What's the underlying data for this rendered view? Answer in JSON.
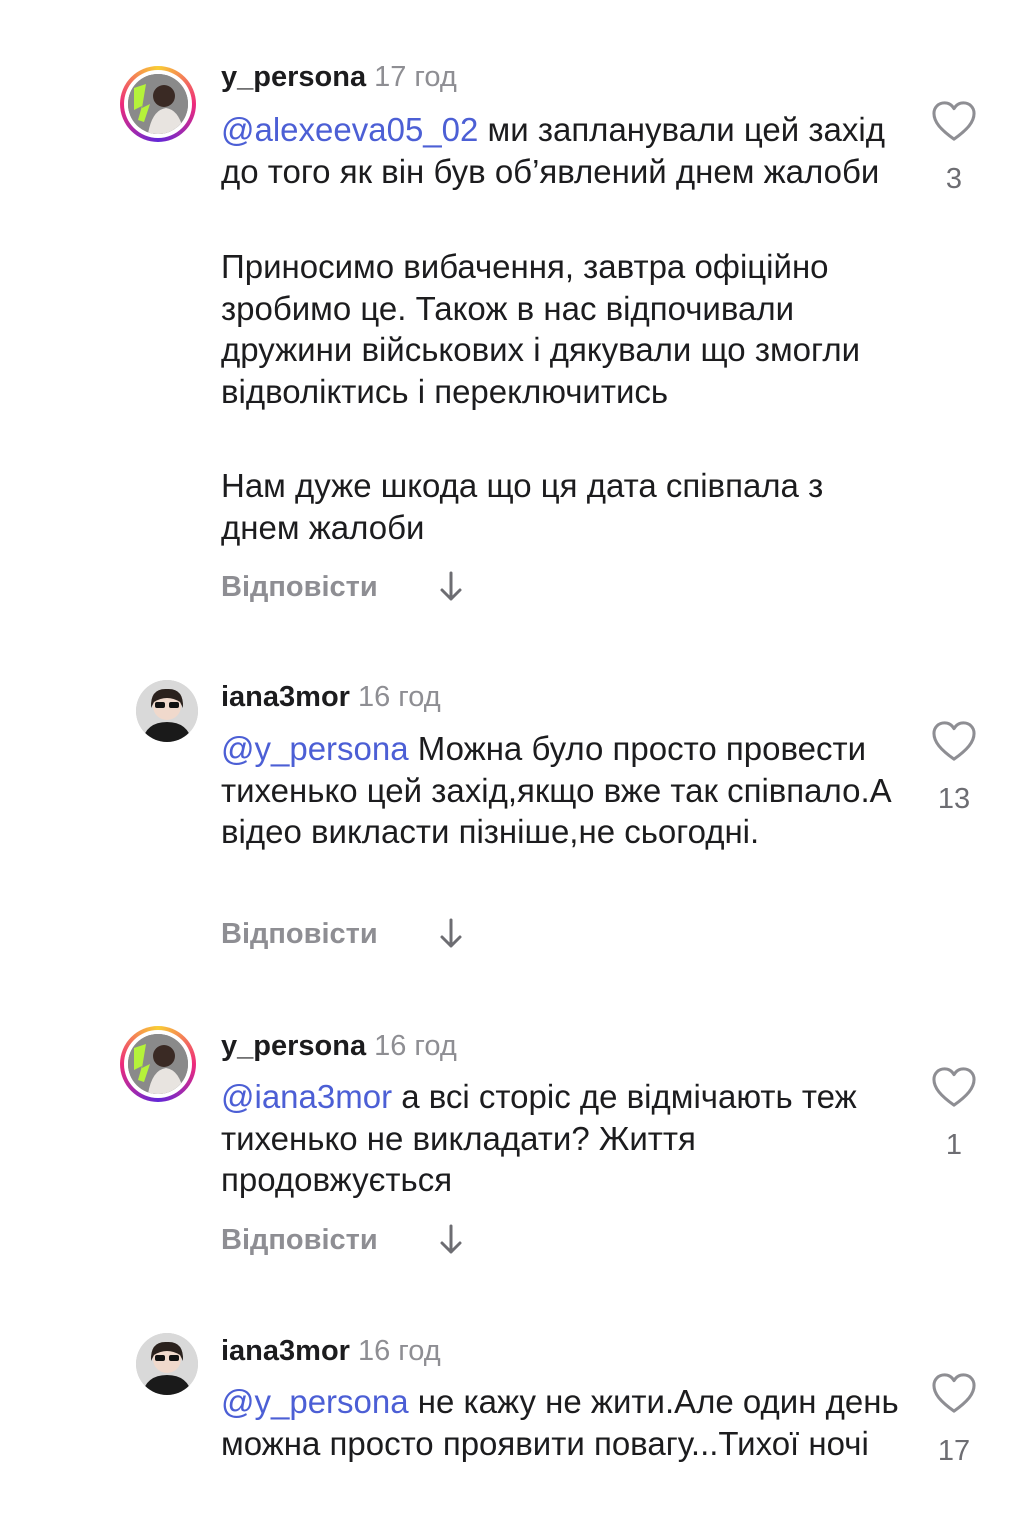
{
  "comments": [
    {
      "username": "y_persona",
      "time": "17 год",
      "avatar": "story-ring-avatar",
      "mention": "@alexeeva05_02",
      "first_text": " ми запланували цей захід до того як він був об’явлений днем жалоби",
      "paragraphs": [
        "Приносимо вибачення, завтра офіційно зробимо це. Також в нас відпочивали дружини військових і дякували що змогли відволіктись і переключитись",
        "Нам дуже шкода що ця дата співпала з днем жалоби"
      ],
      "likes": "3",
      "reply_label": "Відповісти"
    },
    {
      "username": "iana3mor",
      "time": "16 год",
      "avatar": "plain-avatar",
      "mention": "@y_persona",
      "first_text": " Можна було просто провести тихенько цей захід,якщо вже так співпало.А  відео викласти пізніше,не сьогодні.",
      "paragraphs": [],
      "likes": "13",
      "reply_label": "Відповісти"
    },
    {
      "username": "y_persona",
      "time": "16 год",
      "avatar": "story-ring-avatar",
      "mention": "@iana3mor",
      "first_text": " а всі сторіс де відмічають теж тихенько не викладати? Життя продовжується",
      "paragraphs": [],
      "likes": "1",
      "reply_label": "Відповісти"
    },
    {
      "username": "iana3mor",
      "time": "16 год",
      "avatar": "plain-avatar",
      "mention": "@y_persona",
      "first_text": " не кажу не жити.Але один день можна просто проявити повагу...Тихої ночі",
      "paragraphs": [],
      "likes": "17",
      "reply_label": "Відповісти"
    }
  ],
  "icons": {
    "like": "heart-outline-icon",
    "reply_more": "arrow-down-icon"
  },
  "colors": {
    "mention": "#4c5fd5",
    "secondary_text": "#8e8e93",
    "primary_text": "#1c1c1e"
  }
}
